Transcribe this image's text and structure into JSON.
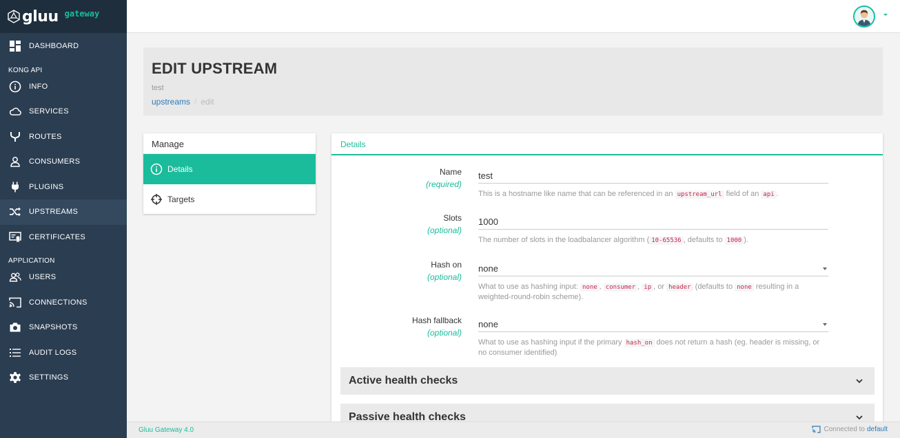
{
  "brand": {
    "logo": "gluu",
    "sub": "gateway"
  },
  "sidebar": {
    "dashboard": "DASHBOARD",
    "group_kong": "KONG API",
    "kong_items": [
      {
        "label": "INFO",
        "icon": "info-icon"
      },
      {
        "label": "SERVICES",
        "icon": "cloud-icon"
      },
      {
        "label": "ROUTES",
        "icon": "route-icon"
      },
      {
        "label": "CONSUMERS",
        "icon": "user-icon"
      },
      {
        "label": "PLUGINS",
        "icon": "plug-icon"
      },
      {
        "label": "UPSTREAMS",
        "icon": "shuffle-icon"
      },
      {
        "label": "CERTIFICATES",
        "icon": "certificate-icon"
      }
    ],
    "group_app": "APPLICATION",
    "app_items": [
      {
        "label": "USERS",
        "icon": "users-icon"
      },
      {
        "label": "CONNECTIONS",
        "icon": "cast-icon"
      },
      {
        "label": "SNAPSHOTS",
        "icon": "camera-icon"
      },
      {
        "label": "AUDIT LOGS",
        "icon": "list-icon"
      },
      {
        "label": "SETTINGS",
        "icon": "gear-icon"
      }
    ]
  },
  "header": {
    "title": "EDIT UPSTREAM",
    "subtitle": "test",
    "breadcrumb": {
      "link": "upstreams",
      "sep": "/",
      "current": "edit"
    }
  },
  "manage": {
    "title": "Manage",
    "items": [
      {
        "label": "Details"
      },
      {
        "label": "Targets"
      }
    ]
  },
  "details": {
    "tab": "Details",
    "name": {
      "label": "Name",
      "hint": "(required)",
      "value": "test",
      "help_1": "This is a hostname like name that can be referenced in an ",
      "code_1": "upstream_url",
      "help_2": " field of an ",
      "code_2": "api",
      "help_3": "."
    },
    "slots": {
      "label": "Slots",
      "hint": "(optional)",
      "value": "1000",
      "help_1": "The number of slots in the loadbalancer algorithm (",
      "code_1": "10-65536",
      "help_2": ", defaults to ",
      "code_2": "1000",
      "help_3": ")."
    },
    "hash_on": {
      "label": "Hash on",
      "hint": "(optional)",
      "value": "none",
      "help_1": "What to use as hashing input: ",
      "code_1": "none",
      "help_2": ", ",
      "code_2": "consumer",
      "help_3": ", ",
      "code_3": "ip",
      "help_4": ", or ",
      "code_4": "header",
      "help_5": " (defaults to ",
      "code_5": "none",
      "help_6": " resulting in a weighted-round-robin scheme)."
    },
    "hash_fallback": {
      "label": "Hash fallback",
      "hint": "(optional)",
      "value": "none",
      "help_1": "What to use as hashing input if the primary ",
      "code_1": "hash_on",
      "help_2": " does not return a hash (eg. header is missing, or no consumer identified)"
    },
    "active_checks": "Active health checks",
    "passive_checks": "Passive health checks"
  },
  "footer": {
    "version": "Gluu Gateway 4.0",
    "connected": "Connected to",
    "target": "default"
  },
  "colors": {
    "accent": "#1abc9c",
    "sidebar": "#2b3d51",
    "link": "#2a7ab8"
  }
}
